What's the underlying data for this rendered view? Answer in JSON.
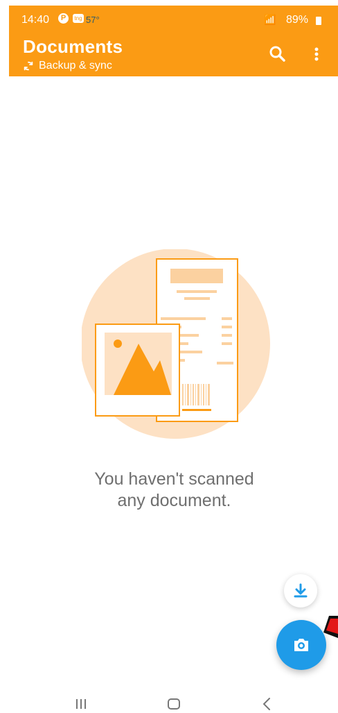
{
  "status": {
    "time": "14:40",
    "pin": "P",
    "badge": "tng",
    "temperature": "57°",
    "battery": "89%"
  },
  "header": {
    "title": "Documents",
    "subtitle": "Backup & sync"
  },
  "empty_state": {
    "line1": "You haven't scanned",
    "line2": "any document."
  },
  "colors": {
    "header": "#fb9b14",
    "fab": "#1f9be8",
    "illustration": "#fb9b14"
  },
  "icons": {
    "search": "search-icon",
    "more": "more-vertical-icon",
    "sync": "sync-icon",
    "download": "download-icon",
    "camera": "camera-icon"
  }
}
